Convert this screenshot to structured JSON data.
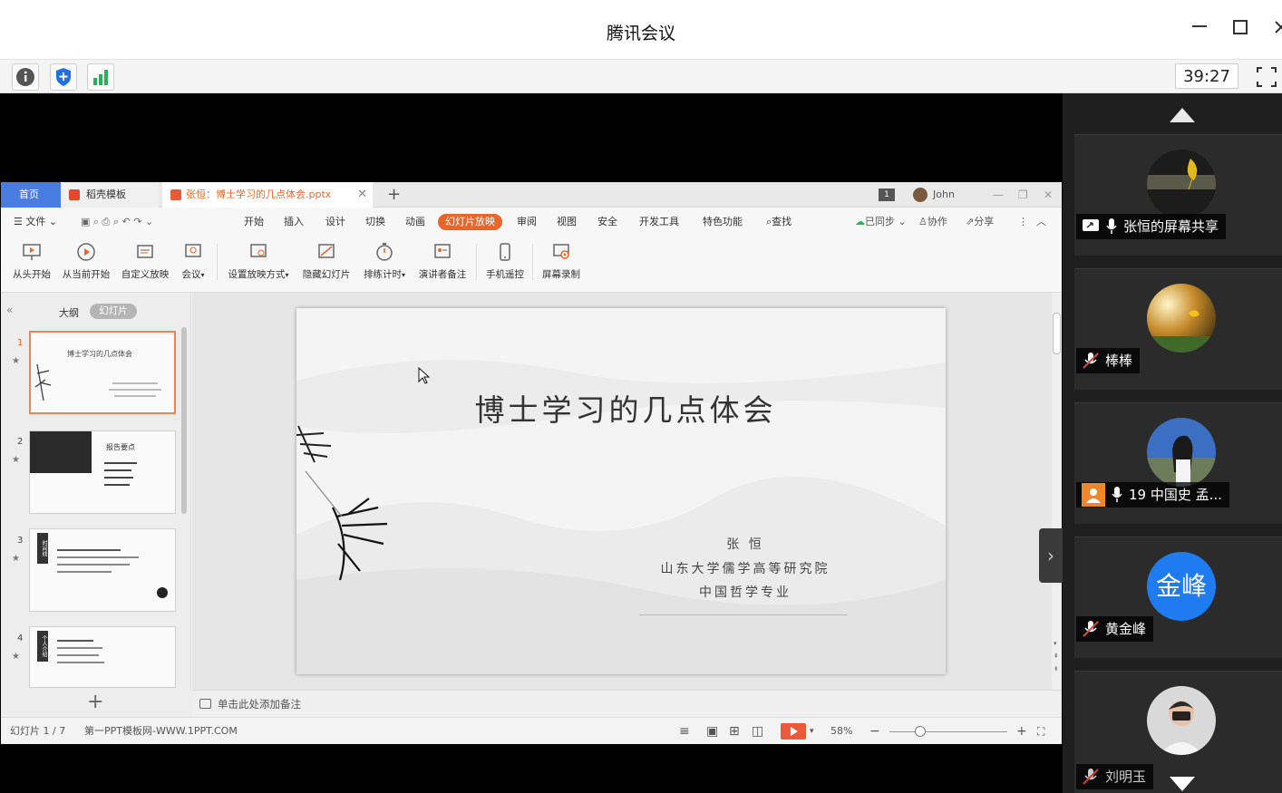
{
  "window": {
    "title": "腾讯会议",
    "minimize_icon": "minimize-icon",
    "maximize_icon": "maximize-icon",
    "close_icon": "close-icon"
  },
  "meeting_toolbar": {
    "info_icon": "info-icon",
    "security_icon": "shield-plus-icon",
    "signal_icon": "signal-bars-icon",
    "timer": "39:27",
    "fullscreen_icon": "fullscreen-icon"
  },
  "wps": {
    "tabs": [
      {
        "label": "首页"
      },
      {
        "label": "稻壳模板"
      },
      {
        "label": "张恒：博士学习的几点体会.pptx"
      }
    ],
    "tab_add": "+",
    "page_badge": "1",
    "user_name": "John",
    "menu": [
      "文件",
      "开始",
      "插入",
      "设计",
      "切换",
      "动画",
      "幻灯片放映",
      "审阅",
      "视图",
      "安全",
      "开发工具",
      "特色功能",
      "查找"
    ],
    "menu_active": "幻灯片放映",
    "menu_right": [
      "已同步",
      "协作",
      "分享"
    ],
    "ribbon": [
      "从头开始",
      "从当前开始",
      "自定义放映",
      "会议",
      "设置放映方式",
      "隐藏幻灯片",
      "排练计时",
      "演讲者备注",
      "手机遥控",
      "屏幕录制"
    ],
    "left_pane": {
      "outline_label": "大纲",
      "slides_label": "幻灯片",
      "thumbs": [
        {
          "num": "1",
          "title": "博士学习的几点体会"
        },
        {
          "num": "2",
          "title": "报告要点"
        },
        {
          "num": "3",
          "title": "时间线"
        },
        {
          "num": "4",
          "title": "个人介绍"
        }
      ]
    },
    "slide": {
      "title": "博士学习的几点体会",
      "author": "张  恒",
      "institution": "山东大学儒学高等研究院",
      "major": "中国哲学专业"
    },
    "notes_placeholder": "单击此处添加备注",
    "status": {
      "slide_count": "幻灯片 1 / 7",
      "template": "第一PPT模板网-WWW.1PPT.COM",
      "zoom": "58%"
    }
  },
  "participants": [
    {
      "name": "张恒的屏幕共享",
      "mic": "mic-on",
      "badge": "screen-share-icon"
    },
    {
      "name": "棒棒",
      "mic": "mic-muted"
    },
    {
      "name": "19 中国史 孟...",
      "mic": "mic-on",
      "badge": "host-icon"
    },
    {
      "name": "黄金峰",
      "mic": "mic-muted",
      "avatar_text": "金峰"
    },
    {
      "name": "刘明玉",
      "mic": "mic-muted"
    }
  ],
  "colors": {
    "wps_accent": "#e8662a",
    "home_tab": "#4a7de1",
    "avatar_blue": "#1f7cf0",
    "host_orange": "#f0862b"
  }
}
